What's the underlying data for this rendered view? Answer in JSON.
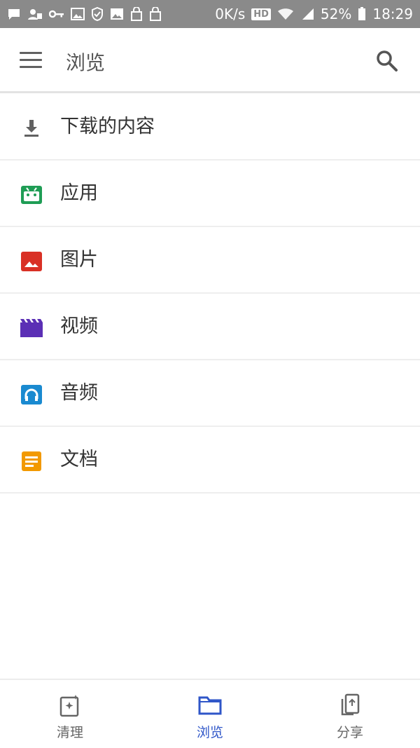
{
  "status_bar": {
    "network_speed": "0K/s",
    "hd_badge": "HD",
    "battery_percent": "52%",
    "time": "18:29",
    "left_icons": [
      "message-icon",
      "image-badge-icon",
      "key-icon",
      "photo-icon",
      "shield-icon",
      "gallery-icon",
      "bag-icon",
      "bag-icon"
    ],
    "right_icons": [
      "wifi-icon",
      "signal-icon",
      "battery-icon"
    ]
  },
  "app_bar": {
    "title": "浏览",
    "menu_icon": "menu-icon",
    "search_icon": "search-icon"
  },
  "categories": [
    {
      "label": "下载的内容",
      "icon": "download-icon",
      "color": "#616161"
    },
    {
      "label": "应用",
      "icon": "android-icon",
      "color": "#1f9d55"
    },
    {
      "label": "图片",
      "icon": "image-icon",
      "color": "#d93025"
    },
    {
      "label": "视频",
      "icon": "video-icon",
      "color": "#5b2fb5"
    },
    {
      "label": "音频",
      "icon": "headphones-icon",
      "color": "#1a8ad0"
    },
    {
      "label": "文档",
      "icon": "document-icon",
      "color": "#f29900"
    }
  ],
  "bottom_nav": {
    "active_color": "#2f56c8",
    "items": [
      {
        "label": "清理",
        "icon": "clean-icon",
        "active": false
      },
      {
        "label": "浏览",
        "icon": "folder-icon",
        "active": true
      },
      {
        "label": "分享",
        "icon": "share-icon",
        "active": false
      }
    ]
  }
}
